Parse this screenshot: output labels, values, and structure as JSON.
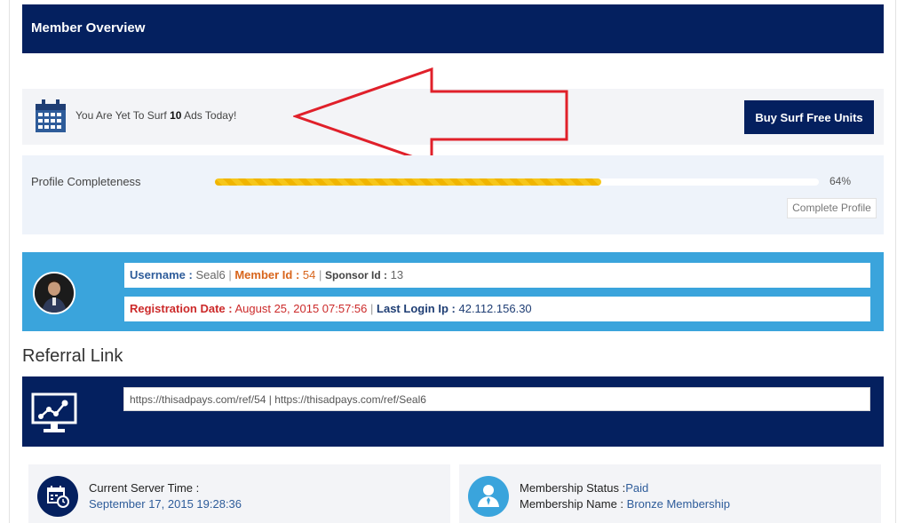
{
  "header": {
    "title": "Member Overview"
  },
  "surf": {
    "text_before": "You Are Yet To Surf ",
    "count": "10",
    "text_after": " Ads Today!",
    "buy_button": "Buy Surf Free Units"
  },
  "profile": {
    "label": "Profile Completeness",
    "percent_value": 64,
    "percent_text": "64%",
    "complete_button": "Complete Profile"
  },
  "member": {
    "username_label": "Username :",
    "username": "Seal6",
    "member_id_label": "Member Id :",
    "member_id": "54",
    "sponsor_id_label": "Sponsor Id :",
    "sponsor_id": "13",
    "registration_label": "Registration Date :",
    "registration_date": "August 25, 2015 07:57:56",
    "last_login_label": "Last Login Ip :",
    "last_login_ip": "42.112.156.30",
    "separator": "|"
  },
  "referral": {
    "heading": "Referral Link",
    "links": "https://thisadpays.com/ref/54 | https://thisadpays.com/ref/Seal6"
  },
  "server_time": {
    "label": "Current Server Time :",
    "value": "September 17, 2015 19:28:36"
  },
  "membership": {
    "status_label": "Membership Status :",
    "status_value": "Paid",
    "name_label": "Membership Name : ",
    "name_value": "Bronze Membership"
  },
  "colors": {
    "navy": "#04205f",
    "sky_blue": "#3aa4dc",
    "progress_yellow": "#f0b500",
    "arrow_red": "#e0202a"
  },
  "icons": [
    "calendar-icon",
    "avatar",
    "presentation-chart-icon",
    "calendar-clock-icon",
    "user-tie-icon",
    "red-arrow-annotation"
  ]
}
